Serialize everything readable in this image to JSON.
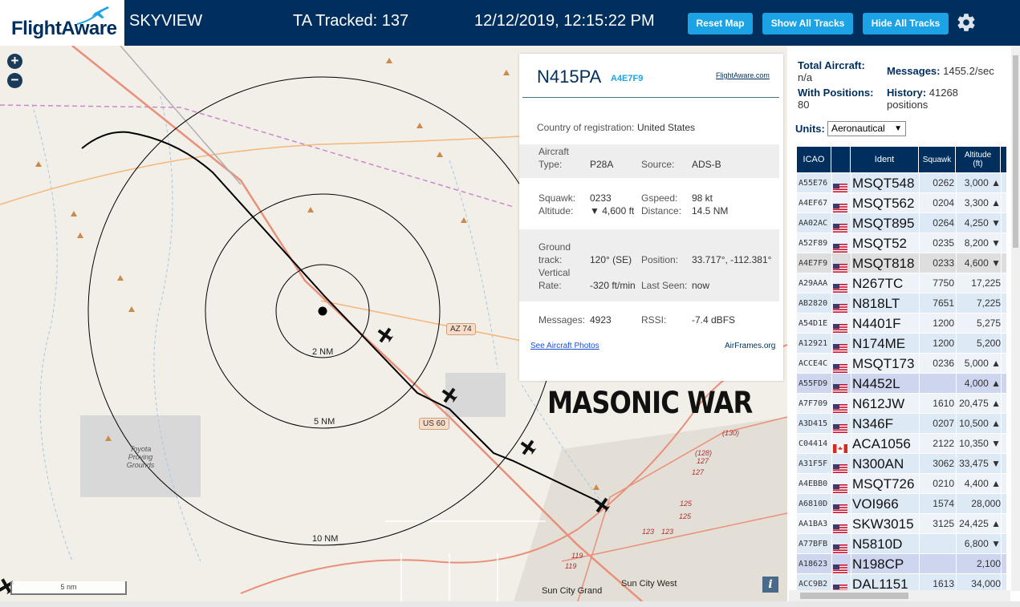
{
  "header": {
    "logo_text": "FlightAware",
    "site_name": "SKYVIEW",
    "tracked": "TA Tracked: 137",
    "datetime": "12/12/2019, 12:15:22 PM",
    "buttons": {
      "reset": "Reset Map",
      "show_all": "Show All Tracks",
      "hide_all": "Hide All Tracks"
    },
    "icons": {
      "logo": "plane-logo-icon",
      "settings": "gear-icon"
    }
  },
  "map": {
    "zoom_in": "+",
    "zoom_out": "−",
    "scale": "5 nm",
    "info": "i",
    "overlay_text": "MASONIC WAR",
    "range_rings": [
      "2 NM",
      "5 NM",
      "10 NM"
    ],
    "road_shields": [
      "AZ 74",
      "US 60"
    ],
    "places": [
      "Toyota Proving Grounds",
      "Sun City Grand",
      "Sun City West"
    ],
    "road_numbers": [
      "(130)",
      "(128)",
      "127",
      "127",
      "125",
      "125",
      "123",
      "123",
      "119",
      "119"
    ],
    "colors": {
      "land": "#f2efe9",
      "highway": "#e8907a",
      "ring": "#000000",
      "track": "#000000"
    }
  },
  "popup": {
    "registration": "N415PA",
    "hex": "A4E7F9",
    "fa_link": "FlightAware.com",
    "country_label": "Country of registration:",
    "country": "United States",
    "aircraft_type_label": "Aircraft Type:",
    "aircraft_type_l1": "Aircraft",
    "aircraft_type_l2": "Type:",
    "aircraft_type": "P28A",
    "source_label": "Source:",
    "source": "ADS-B",
    "squawk_label": "Squawk:",
    "squawk": "0233",
    "gspeed_label": "Gspeed:",
    "gspeed": "98 kt",
    "altitude_label": "Altitude:",
    "altitude": "▼ 4,600 ft",
    "distance_label": "Distance:",
    "distance": "14.5 NM",
    "ground_track_l1": "Ground",
    "ground_track_l2": "track:",
    "ground_track": "120° (SE)",
    "position_label": "Position:",
    "position": "33.717°, -112.381°",
    "vrate_l1": "Vertical",
    "vrate_l2": "Rate:",
    "vrate": "-320 ft/min",
    "last_seen_label": "Last Seen:",
    "last_seen": "now",
    "messages_label": "Messages:",
    "messages": "4923",
    "rssi_label": "RSSI:",
    "rssi": "-7.4 dBFS",
    "photos_link": "See Aircraft Photos",
    "airframes_link": "AirFrames.org"
  },
  "sidebar": {
    "total_label": "Total Aircraft:",
    "total_value": "n/a",
    "messages_label": "Messages:",
    "messages_value": "1455.2/sec",
    "with_pos_label": "With Positions:",
    "with_pos_value": "80",
    "history_label": "History:",
    "history_value": "41268",
    "history_unit": "positions",
    "units_label": "Units:",
    "units_value": "Aeronautical",
    "columns": {
      "icao": "ICAO",
      "ident": "Ident",
      "squawk": "Squawk",
      "alt_l1": "Altitude",
      "alt_l2": "(ft)"
    },
    "rows": [
      {
        "icao": "A55E76",
        "flag": "us",
        "ident": "MSQT548",
        "squawk": "0262",
        "alt": "3,000 ▲",
        "style": "even"
      },
      {
        "icao": "A4EF67",
        "flag": "us",
        "ident": "MSQT562",
        "squawk": "0204",
        "alt": "3,300 ▲",
        "style": "odd"
      },
      {
        "icao": "AA02AC",
        "flag": "us",
        "ident": "MSQT895",
        "squawk": "0264",
        "alt": "4,250 ▼",
        "style": "even"
      },
      {
        "icao": "A52F89",
        "flag": "us",
        "ident": "MSQT52",
        "squawk": "0235",
        "alt": "8,200 ▼",
        "style": "odd"
      },
      {
        "icao": "A4E7F9",
        "flag": "us",
        "ident": "MSQT818",
        "squawk": "0233",
        "alt": "4,600 ▼",
        "style": "selected"
      },
      {
        "icao": "A29AAA",
        "flag": "us",
        "ident": "N267TC",
        "squawk": "7750",
        "alt": "17,225",
        "style": "odd"
      },
      {
        "icao": "AB2820",
        "flag": "us",
        "ident": "N818LT",
        "squawk": "7651",
        "alt": "7,225",
        "style": "even"
      },
      {
        "icao": "A54D1E",
        "flag": "us",
        "ident": "N4401F",
        "squawk": "1200",
        "alt": "5,275",
        "style": "odd"
      },
      {
        "icao": "A12921",
        "flag": "us",
        "ident": "N174ME",
        "squawk": "1200",
        "alt": "5,200",
        "style": "even"
      },
      {
        "icao": "ACCE4C",
        "flag": "us",
        "ident": "MSQT173",
        "squawk": "0236",
        "alt": "5,000 ▲",
        "style": "odd"
      },
      {
        "icao": "A55FD9",
        "flag": "us",
        "ident": "N4452L",
        "squawk": "",
        "alt": "4,000 ▲",
        "style": "noLoc"
      },
      {
        "icao": "A7F709",
        "flag": "us",
        "ident": "N612JW",
        "squawk": "1610",
        "alt": "20,475 ▲",
        "style": "odd"
      },
      {
        "icao": "A3D415",
        "flag": "us",
        "ident": "N346F",
        "squawk": "0207",
        "alt": "10,500 ▲",
        "style": "even"
      },
      {
        "icao": "C04414",
        "flag": "ca",
        "ident": "ACA1056",
        "squawk": "2122",
        "alt": "10,350 ▼",
        "style": "odd"
      },
      {
        "icao": "A31F5F",
        "flag": "us",
        "ident": "N300AN",
        "squawk": "3062",
        "alt": "33,475 ▼",
        "style": "even"
      },
      {
        "icao": "A4EBB0",
        "flag": "us",
        "ident": "MSQT726",
        "squawk": "0210",
        "alt": "4,400 ▲",
        "style": "odd"
      },
      {
        "icao": "A6810D",
        "flag": "us",
        "ident": "VOI966",
        "squawk": "1574",
        "alt": "28,000",
        "style": "even"
      },
      {
        "icao": "AA1BA3",
        "flag": "us",
        "ident": "SKW3015",
        "squawk": "3125",
        "alt": "24,425 ▲",
        "style": "odd"
      },
      {
        "icao": "A77BFB",
        "flag": "us",
        "ident": "N5810D",
        "squawk": "",
        "alt": "6,800 ▼",
        "style": "even"
      },
      {
        "icao": "A18623",
        "flag": "us",
        "ident": "N198CP",
        "squawk": "",
        "alt": "2,100",
        "style": "noLoc"
      },
      {
        "icao": "ACC9B2",
        "flag": "us",
        "ident": "DAL1151",
        "squawk": "1613",
        "alt": "34,000",
        "style": "even"
      }
    ]
  }
}
